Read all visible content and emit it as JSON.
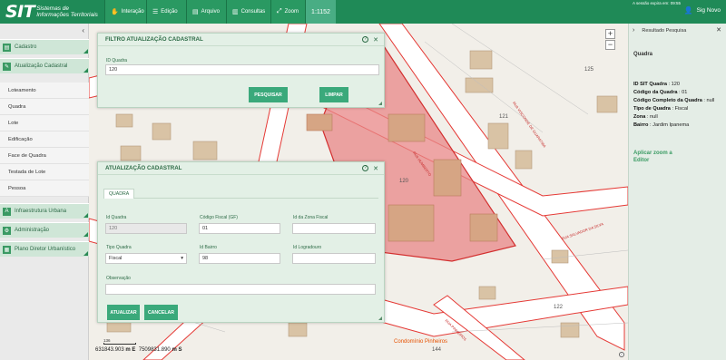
{
  "app": {
    "logo_main": "SIT",
    "logo_sub": "Sistemas de Informações Territoriais",
    "session_text": "A sessão expira em: 09:55",
    "user_label": "Sig Novo"
  },
  "toolbar": {
    "interacao": "Interação",
    "edicao": "Edição",
    "arquivo": "Arquivo",
    "consultas": "Consultas",
    "zoom": "Zoom",
    "scale": "1:1152"
  },
  "sidebar": {
    "collapse": "‹",
    "cadastro": "Cadastro",
    "atualizacao": "Atualização Cadastral",
    "items": [
      "Loteamento",
      "Quadra",
      "Lote",
      "Edificação",
      "Face de Quadra",
      "Testada de Lote",
      "Pessoa"
    ],
    "infra": "Infraestrutura Urbana",
    "admin": "Administração",
    "plano": "Plano Diretor Urbanístico"
  },
  "filtro": {
    "title": "FILTRO ATUALIZAÇÃO CADASTRAL",
    "id_label": "ID Quadra",
    "id_value": "120",
    "pesquisar": "PESQUISAR",
    "limpar": "LIMPAR"
  },
  "atualizacao": {
    "title": "ATUALIZAÇÃO CADASTRAL",
    "tab": "QUADRA",
    "id_quadra_label": "Id Quadra",
    "id_quadra_value": "120",
    "codigo_fiscal_label": "Código Fiscal (GF)",
    "codigo_fiscal_value": "01",
    "id_zona_label": "Id da Zona Fiscal",
    "id_zona_value": "",
    "tipo_quadra_label": "Tipo Quadra",
    "tipo_quadra_value": "Fiscal",
    "id_bairro_label": "Id Bairro",
    "id_bairro_value": "98",
    "id_logradouro_label": "Id Logradouro",
    "id_logradouro_value": "",
    "observacao_label": "Observação",
    "observacao_value": "",
    "atualizar": "ATUALIZAR",
    "cancelar": "CANCELAR"
  },
  "map": {
    "zoom_in": "+",
    "zoom_out": "−",
    "coord_x": "631843.903",
    "coord_x_unit": "m E",
    "coord_y": "7509831.890",
    "coord_y_unit": "m S",
    "scale_label": "136",
    "labels": {
      "n125": "125",
      "n121": "121",
      "n120": "120",
      "n122": "122",
      "n144": "144",
      "condominio": "Condomínio Pinheiros",
      "rua1": "RUA VISCONDE DE GUARATIBA",
      "rua2": "RUA HUMBERTO",
      "rua3": "RUA SALVADOR DA SILVA",
      "rua4": "RUA PINHEIROS"
    }
  },
  "result": {
    "header": "Resultado Pesquisa",
    "title": "Quadra",
    "rows": [
      {
        "k": "ID SIT Quadra",
        "v": "120"
      },
      {
        "k": "Código da Quadra",
        "v": "01"
      },
      {
        "k": "Código Completo da Quadra",
        "v": "null"
      },
      {
        "k": "Tipo de Quadra",
        "v": "Fiscal"
      },
      {
        "k": "Zona",
        "v": "null"
      },
      {
        "k": "Bairro",
        "v": "Jardim Ipanema"
      }
    ],
    "zoom_link": "Aplicar zoom a Editor"
  },
  "colors": {
    "brand": "#1f8a57",
    "button": "#3aa97b",
    "highlight": "#e88787",
    "road_edge": "#e53935",
    "building": "#d9b48f"
  }
}
